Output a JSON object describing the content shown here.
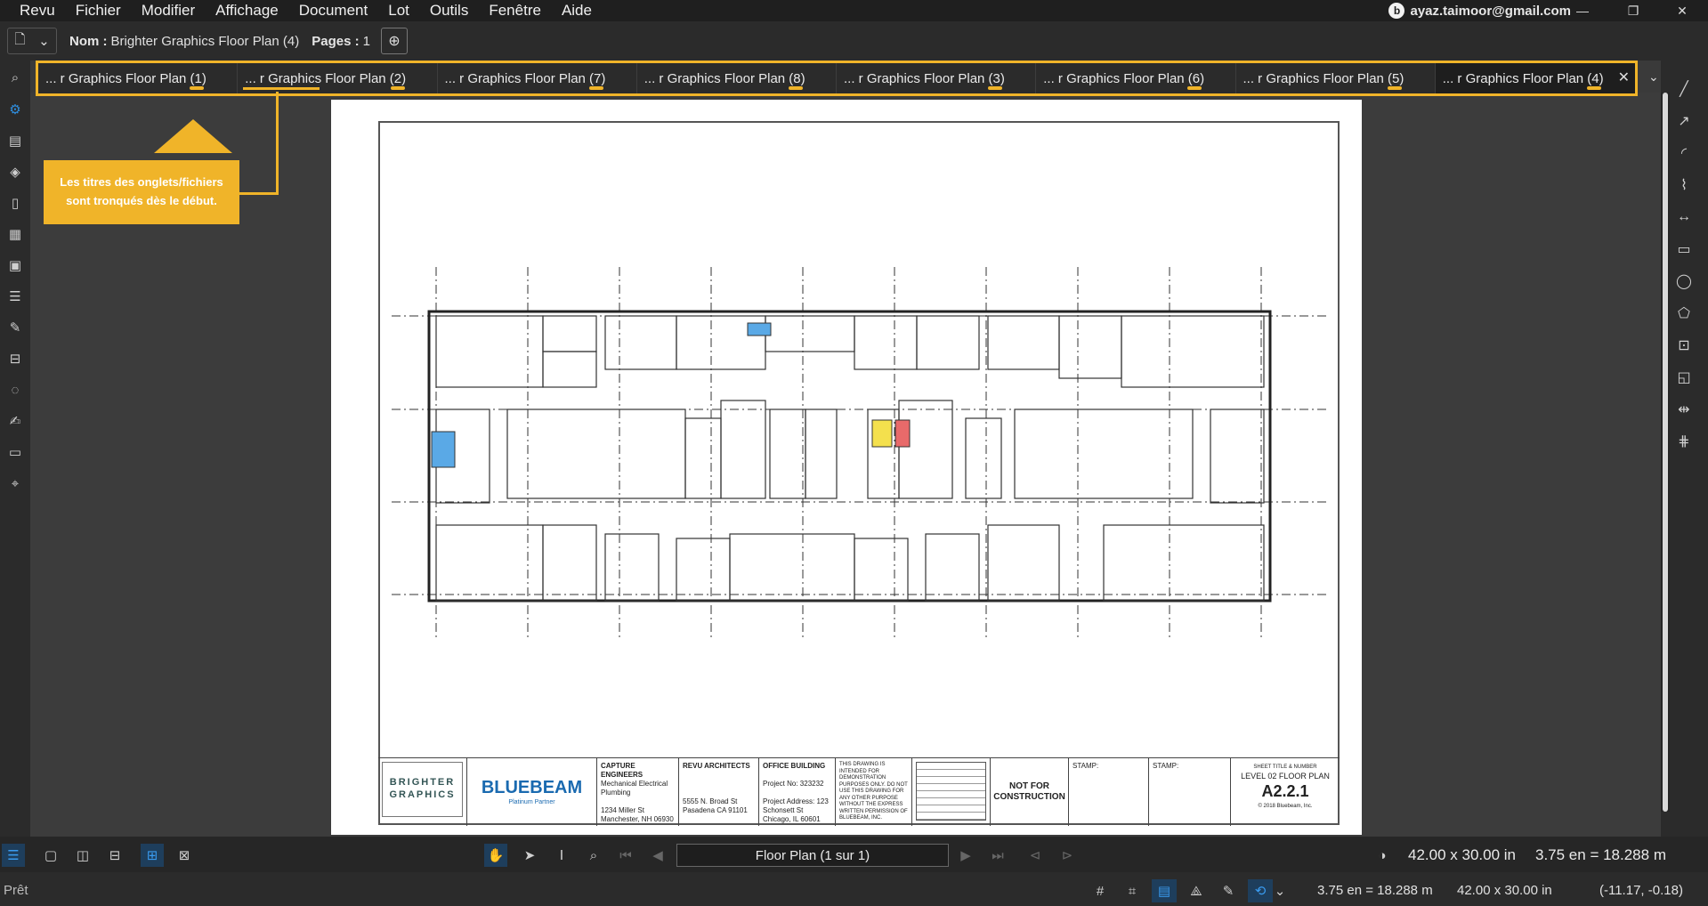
{
  "menubar": {
    "items": [
      "Revu",
      "Fichier",
      "Modifier",
      "Affichage",
      "Document",
      "Lot",
      "Outils",
      "Fenêtre",
      "Aide"
    ],
    "account": "ayaz.taimoor@gmail.com"
  },
  "docbar": {
    "name_label": "Nom :",
    "name_value": "Brighter Graphics Floor Plan (4)",
    "pages_label": "Pages :",
    "pages_value": "1"
  },
  "tabs": [
    {
      "label": "... r Graphics Floor Plan (1)"
    },
    {
      "label": "... r Graphics Floor Plan (2)"
    },
    {
      "label": "... r Graphics Floor Plan (7)"
    },
    {
      "label": "... r Graphics Floor Plan (8)"
    },
    {
      "label": "... r Graphics Floor Plan (3)"
    },
    {
      "label": "... r Graphics Floor Plan (6)"
    },
    {
      "label": "... r Graphics Floor Plan (5)"
    },
    {
      "label": "... r Graphics Floor Plan (4)"
    }
  ],
  "callout": {
    "line1": "Les titres des onglets/fichiers",
    "line2": "sont tronqués dès le début."
  },
  "titleblock": {
    "company1": "BRIGHTER",
    "company2": "GRAPHICS",
    "partner_logo": "BLUEBEAM",
    "partner_sub": "Platinum Partner",
    "capture_title": "CAPTURE ENGINEERS",
    "capture_lines": "Mechanical Electrical Plumbing",
    "capture_addr": "1234 Miller St Manchester, NH 06930",
    "revu_title": "REVU ARCHITECTS",
    "revu_addr": "5555 N. Broad St Pasadena CA 91101",
    "office_title": "OFFICE BUILDING",
    "project_no": "Project No: 323232",
    "project_addr": "Project Address: 123 Schonsett St Chicago, IL 60601",
    "notice": "THIS DRAWING IS INTENDED FOR DEMONSTRATION PURPOSES ONLY. DO NOT USE THIS DRAWING FOR ANY OTHER PURPOSE WITHOUT THE EXPRESS WRITTEN PERMISSION OF BLUEBEAM, INC.",
    "nfc": "NOT FOR CONSTRUCTION",
    "stamp1": "STAMP:",
    "stamp2": "STAMP:",
    "sheet_title_label": "SHEET TITLE & NUMBER",
    "sheet_title": "LEVEL 02 FLOOR PLAN",
    "sheet_number": "A2.2.1",
    "copyright": "© 2018 Bluebeam, Inc."
  },
  "bottombar": {
    "page_field": "Floor Plan (1 sur 1)",
    "size": "42.00 x 30.00 in",
    "scale": "3.75 en = 18.288 m"
  },
  "statusbar": {
    "status": "Prêt",
    "scale": "3.75 en = 18.288 m",
    "size": "42.00 x 30.00 in",
    "coords": "(-11.17, -0.18)"
  },
  "icons": {
    "accent": "#f0b429",
    "active_blue": "#2f8fe0"
  }
}
